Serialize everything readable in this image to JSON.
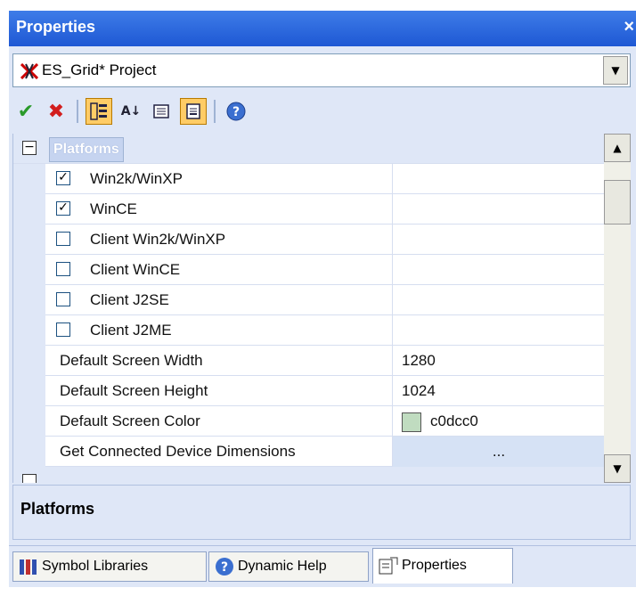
{
  "window": {
    "title": "Properties",
    "close_glyph": "×"
  },
  "object_selector": {
    "value": "ES_Grid* Project",
    "icon": "project-logo-icon",
    "arrow_icon": "dropdown-arrow-icon"
  },
  "toolbar": {
    "buttons": [
      {
        "name": "apply-icon",
        "glyph": "✔",
        "color": "#2a9a2a"
      },
      {
        "name": "cancel-icon",
        "glyph": "✖",
        "color": "#d21d1d"
      },
      {
        "name": "categorized-icon",
        "active": true
      },
      {
        "name": "alphabetical-icon",
        "glyph": "A↓Z"
      },
      {
        "name": "property-pages-icon"
      },
      {
        "name": "description-toggle-icon",
        "active": true
      },
      {
        "name": "help-icon",
        "glyph": "?"
      }
    ]
  },
  "grid": {
    "category": {
      "label": "Platforms",
      "toggle": "−"
    },
    "rows": [
      {
        "name": "Win2k/WinXP",
        "checked": true,
        "check_glyph": "✓"
      },
      {
        "name": "WinCE",
        "checked": true,
        "check_glyph": "✓"
      },
      {
        "name": "Client Win2k/WinXP",
        "checked": false,
        "check_glyph": ""
      },
      {
        "name": "Client WinCE",
        "checked": false,
        "check_glyph": ""
      },
      {
        "name": "Client J2SE",
        "checked": false,
        "check_glyph": ""
      },
      {
        "name": "Client J2ME",
        "checked": false,
        "check_glyph": ""
      },
      {
        "name": "Default Screen Width",
        "value": "1280"
      },
      {
        "name": "Default Screen Height",
        "value": "1024"
      },
      {
        "name": "Default Screen Color",
        "value": "c0dcc0",
        "swatch": "#c0dcc0"
      },
      {
        "name": "Get Connected Device Dimensions",
        "value": "..."
      }
    ]
  },
  "description": {
    "title": "Platforms"
  },
  "tabs": [
    {
      "label": "Symbol Libraries",
      "icon": "symbol-libraries-icon",
      "active": false
    },
    {
      "label": "Dynamic Help",
      "icon": "dynamic-help-icon",
      "active": false
    },
    {
      "label": "Properties",
      "icon": "properties-icon",
      "active": true
    }
  ],
  "colors": {
    "title_bar": "#2461d9",
    "panel_bg": "#dfe7f7",
    "active_button": "#ffcc66"
  }
}
